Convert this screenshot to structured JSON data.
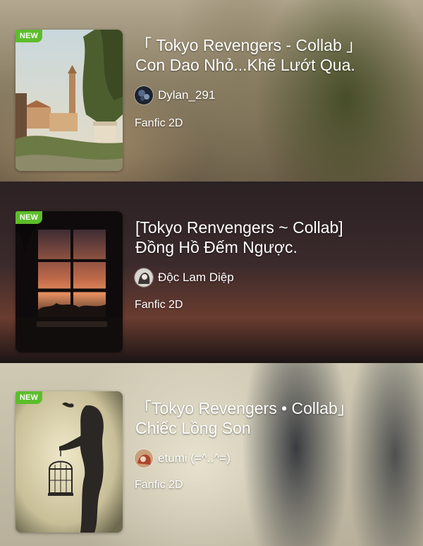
{
  "stories": [
    {
      "badge": "NEW",
      "title_line1": "「 Tokyo Revengers - Collab 」",
      "title_line2": "Con Dao Nhỏ...Khẽ Lướt Qua.",
      "author": "Dylan_291",
      "category": "Fanfic 2D"
    },
    {
      "badge": "NEW",
      "title_line1": "[Tokyo Renvengers ~ Collab]",
      "title_line2": "Đồng Hồ Đếm Ngược.",
      "author": "Độc Lam Diệp",
      "category": "Fanfic 2D"
    },
    {
      "badge": "NEW",
      "title_line1": "「Tokyo Revengers • Collab」",
      "title_line2": "Chiếc Lồng Son",
      "author": "etumi (=^..^=)",
      "category": "Fanfic 2D"
    }
  ],
  "colors": {
    "badge_green": "#5dbd2b",
    "text_white": "#ffffff"
  },
  "icons": {
    "story_1_cover": "painting-city-tower-cover",
    "story_2_cover": "window-sunset-silhouette-cover",
    "story_3_cover": "birdcage-silhouette-cover"
  }
}
